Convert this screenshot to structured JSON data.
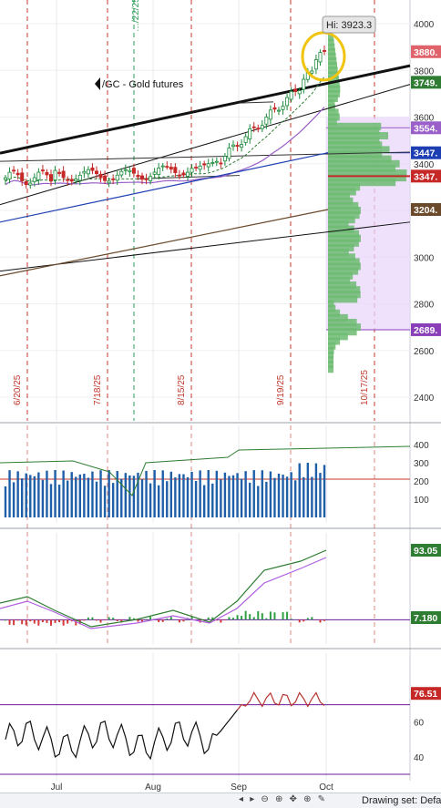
{
  "chart_data": [
    {
      "type": "candlestick",
      "title": "/GC - Gold futures",
      "annotation": "Hi: 3923.3",
      "ylim": [
        2300,
        4080
      ],
      "y_ticks": [
        4000,
        3800,
        3600,
        3400,
        3200,
        3000,
        2800,
        2600,
        2400
      ],
      "date_markers": [
        "6/20/25",
        "7/18/25",
        "8/15/25",
        "9/19/25",
        "10/17/25"
      ],
      "markers_partial": [
        "…/22/25"
      ],
      "price_labels": [
        {
          "value": "3880.",
          "color": "#e0626a"
        },
        {
          "value": "3749.",
          "color": "#2e7d32"
        },
        {
          "value": "3554.",
          "color": "#9a5fc8"
        },
        {
          "value": "3447.",
          "color": "#1d3fb3"
        },
        {
          "value": "3347.",
          "color": "#c62828"
        },
        {
          "value": "3204.",
          "color": "#6b4a2b"
        },
        {
          "value": "2689.",
          "color": "#8a3fb8"
        }
      ],
      "highlight_color": "#f1c40f"
    },
    {
      "type": "bar",
      "name": "volume",
      "ylim": [
        0,
        450
      ],
      "y_ticks": [
        400,
        300,
        200,
        100
      ],
      "reference_line": 210
    },
    {
      "type": "line",
      "name": "oscillator",
      "labels": [
        "93.05",
        "7.180"
      ],
      "label_colors": [
        "#2e7d32",
        "#2e7d32"
      ]
    },
    {
      "type": "line",
      "name": "rsi",
      "ylim": [
        30,
        85
      ],
      "y_ticks": [
        60,
        40
      ],
      "levels": [
        70,
        30
      ],
      "label": "76.51",
      "label_color": "#c62828"
    }
  ],
  "x_axis_labels": [
    "Jul",
    "Aug",
    "Sep",
    "Oct"
  ],
  "footer": {
    "drawing_set": "Drawing set: Defa",
    "buttons": "◂ ▸ ⊖ ⊕ ✥ ⊕ ✎"
  }
}
